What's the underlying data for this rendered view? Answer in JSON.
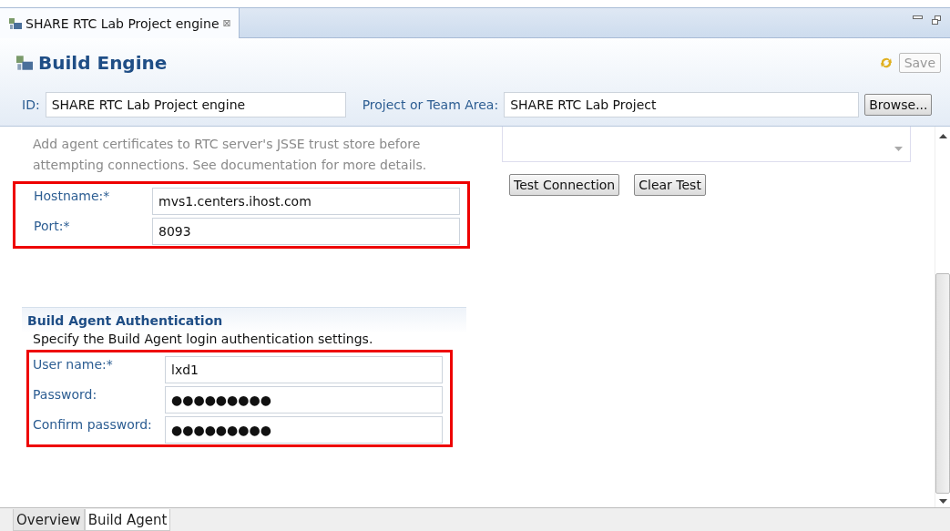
{
  "editor_tab": {
    "title": "SHARE RTC Lab Project engine",
    "close": "⊠"
  },
  "header": {
    "title": "Build Engine",
    "save": {
      "label": "Save",
      "disabled": true
    },
    "id_label": "ID:",
    "id_value": "SHARE RTC Lab Project engine",
    "area_label": "Project or Team Area:",
    "area_value": "SHARE RTC Lab Project",
    "browse": "Browse..."
  },
  "note": "Add agent certificates to RTC server's JSSE trust store before attempting connections.  See documentation for more details.",
  "connection_fields": {
    "highlighted": true,
    "fields": [
      {
        "label": "Hostname:*",
        "value": "mvs1.centers.ihost.com"
      },
      {
        "label": "Port:*",
        "value": "8093"
      }
    ]
  },
  "connection_buttons": [
    "Test Connection",
    "Clear Test"
  ],
  "auth": {
    "title": "Build Agent Authentication",
    "description": "Specify the Build Agent login authentication settings.",
    "highlighted": true,
    "fields": [
      {
        "label": "User name:*",
        "value": "lxd1"
      },
      {
        "label": "Password:",
        "value": "●●●●●●●●●"
      },
      {
        "label": "Confirm password:",
        "value": "●●●●●●●●●"
      }
    ]
  },
  "page_tabs": [
    {
      "label": "Overview",
      "selected": false
    },
    {
      "label": "Build Agent",
      "selected": true
    }
  ]
}
